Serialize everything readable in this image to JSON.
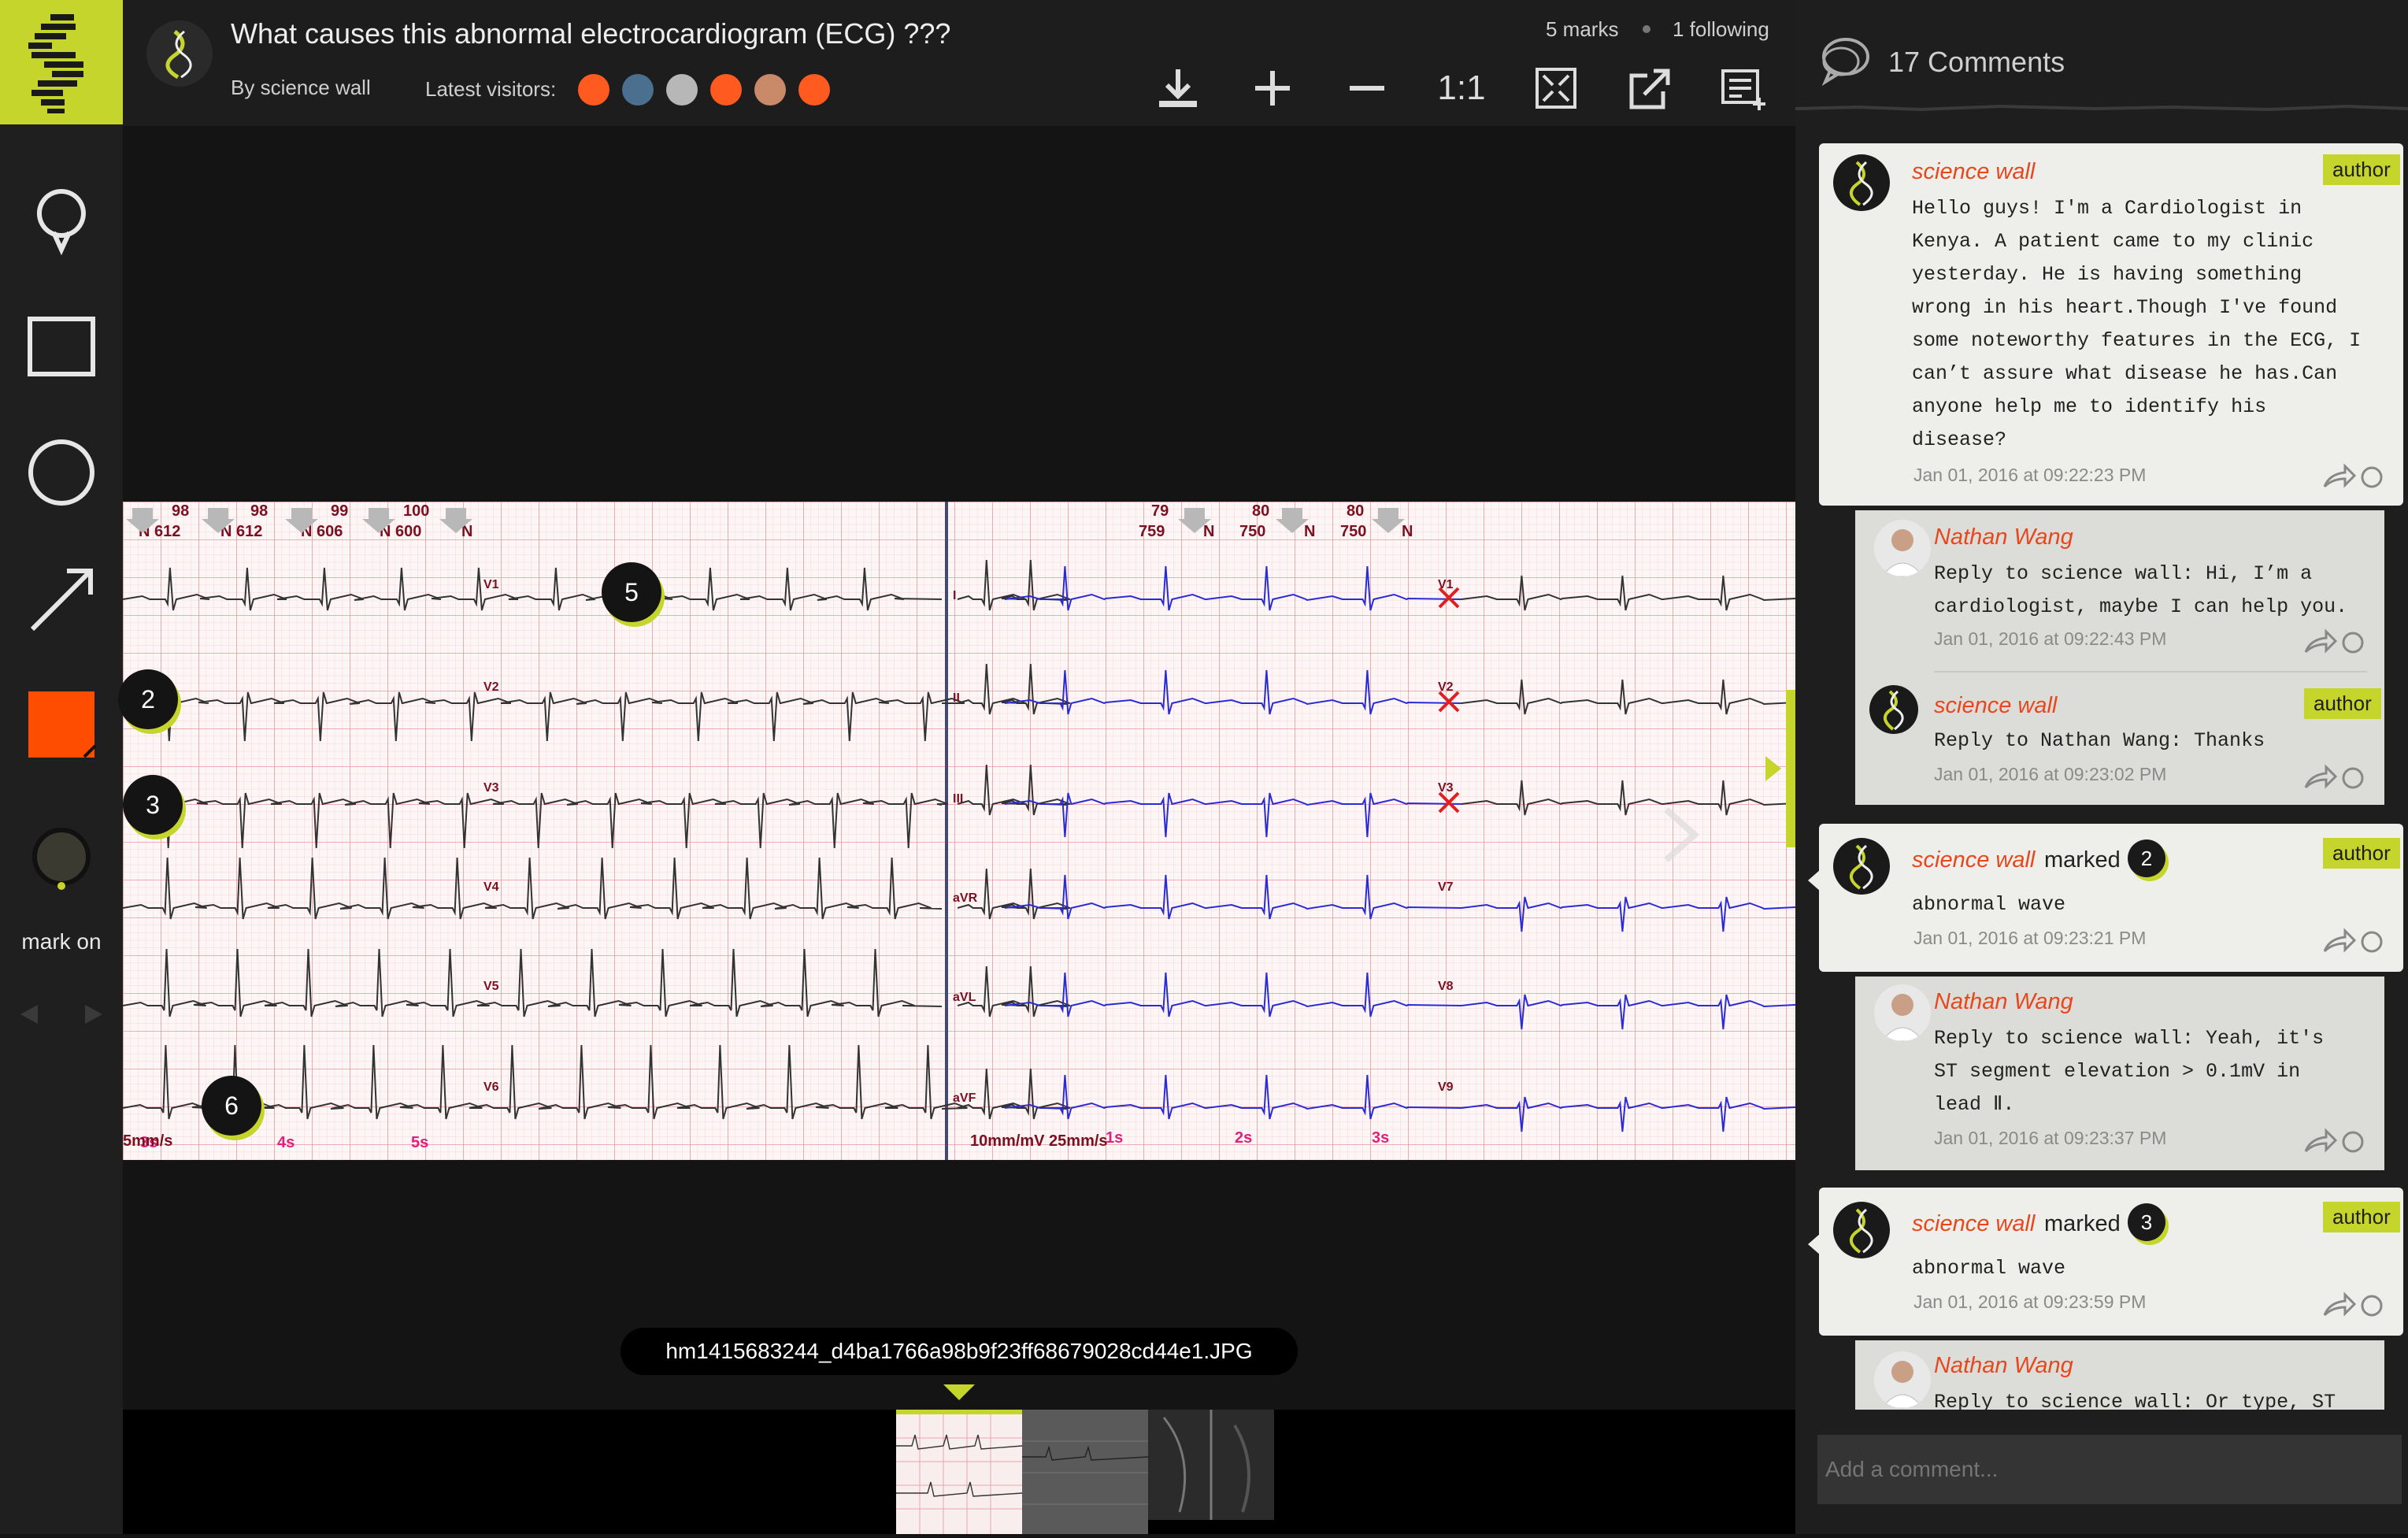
{
  "header": {
    "title": "What causes this abnormal electrocardiogram (ECG) ???",
    "byline": "By science wall",
    "visitors_label": "Latest visitors:",
    "marks_count": "5 marks",
    "following": "1 following",
    "zoom_label": "1:1"
  },
  "toolbar": {
    "mark_on_label": "mark on",
    "active_color": "#ff4d00"
  },
  "viewer": {
    "filename": "hm1415683244_d4ba1766a98b9f23ff68679028cd44e1.JPG",
    "pins": [
      "5",
      "2",
      "3",
      "6"
    ],
    "ecg": {
      "top_left_values": [
        "98",
        "98",
        "99",
        "100"
      ],
      "top_left_labels": [
        "N 612",
        "N 612",
        "N 606",
        "N 600",
        "N"
      ],
      "top_right_values": [
        "79",
        "80",
        "80"
      ],
      "top_right_labels": [
        "759",
        "N",
        "750",
        "N",
        "750",
        "N"
      ],
      "left_leads": [
        "V1",
        "V2",
        "V3",
        "V4",
        "V5",
        "V6"
      ],
      "middle_leads": [
        "I",
        "II",
        "III",
        "aVR",
        "aVL",
        "aVF"
      ],
      "right_leads": [
        "V1",
        "V2",
        "V3",
        "V7",
        "V8",
        "V9"
      ],
      "bottom_left": [
        "3s",
        "4s",
        "5s"
      ],
      "speed_label": "5mm/s",
      "calibration_label": "10mm/mV  25mm/s",
      "bottom_right": [
        "1s",
        "2s",
        "3s"
      ]
    }
  },
  "comments": {
    "title": "17 Comments",
    "input_placeholder": "Add a comment...",
    "items": [
      {
        "name": "science wall",
        "badge": "author",
        "text": "Hello guys! I'm a Cardiologist in\nKenya. A patient came to my clinic\nyesterday. He is having something\nwrong in his heart.Though I've found\nsome noteworthy features in the ECG, I\ncan’t assure what disease he has.Can\nanyone help me to identify his\ndisease?",
        "date": "Jan 01, 2016 at 09:22:23 PM"
      },
      {
        "name": "Nathan Wang",
        "text": "Reply to science wall: Hi, I’m a\ncardiologist, maybe I can help you.",
        "date": "Jan 01, 2016 at 09:22:43 PM"
      },
      {
        "name": "science wall",
        "badge": "author",
        "text": "Reply to Nathan Wang: Thanks",
        "date": "Jan 01, 2016 at 09:23:02 PM"
      },
      {
        "name": "science wall",
        "marked": "marked",
        "mark": "2",
        "badge": "author",
        "text": "abnormal wave",
        "date": "Jan 01, 2016 at 09:23:21 PM"
      },
      {
        "name": "Nathan Wang",
        "text": "Reply to science wall: Yeah, it's\nST segment elevation > 0.1mV in\nlead Ⅱ.",
        "date": "Jan 01, 2016 at 09:23:37 PM"
      },
      {
        "name": "science wall",
        "marked": "marked",
        "mark": "3",
        "badge": "author",
        "text": "abnormal wave",
        "date": "Jan 01, 2016 at 09:23:59 PM"
      },
      {
        "name": "Nathan Wang",
        "text": "Reply to science wall: Or type, ST"
      }
    ]
  }
}
